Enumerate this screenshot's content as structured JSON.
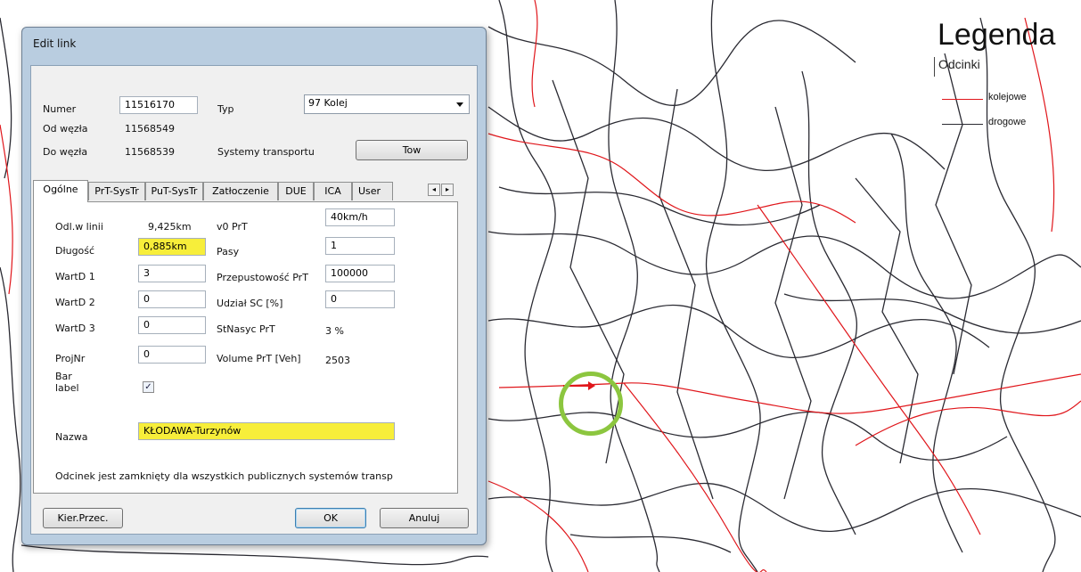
{
  "colors": {
    "rail": "#e0161b",
    "road": "#2a2a32",
    "highlight": "#f7ee3a",
    "marker": "#8cc63f"
  },
  "legend": {
    "title": "Legenda",
    "subtitle": "Odcinki",
    "items": [
      {
        "label": "kolejowe",
        "color": "#e0161b"
      },
      {
        "label": "drogowe",
        "color": "#2a2a32"
      }
    ]
  },
  "dialog": {
    "title": "Edit link",
    "numer_label": "Numer",
    "numer_value": "11516170",
    "typ_label": "Typ",
    "typ_value": "97 Kolej",
    "od_label": "Od węzła",
    "od_value": "11568549",
    "do_label": "Do węzła",
    "do_value": "11568539",
    "systemy_label": "Systemy transportu",
    "systemy_button": "Tow",
    "tabs": [
      "Ogólne",
      "PrT-SysTr",
      "PuT-SysTr",
      "Zatłoczenie",
      "DUE",
      "ICA",
      "User"
    ],
    "general": {
      "odl_label": "Odl.w linii",
      "odl_value": "9,425km",
      "dlugosc_label": "Długość",
      "dlugosc_value": "0,885km",
      "wartd1_label": "WartD 1",
      "wartd1_value": "3",
      "wartd2_label": "WartD 2",
      "wartd2_value": "0",
      "wartd3_label": "WartD 3",
      "wartd3_value": "0",
      "projnr_label": "ProjNr",
      "projnr_value": "0",
      "barlabel_label_1": "Bar",
      "barlabel_label_2": "label",
      "barlabel_checked": "✓",
      "v0_label": "v0 PrT",
      "v0_value": "40km/h",
      "pasy_label": "Pasy",
      "pasy_value": "1",
      "przep_label": "Przepustowość PrT",
      "przep_value": "100000",
      "udzial_label": "Udział SC [%]",
      "udzial_value": "0",
      "stnasyc_label": "StNasyc PrT",
      "stnasyc_value": "3 %",
      "volume_label": "Volume PrT [Veh]",
      "volume_value": "2503",
      "nazwa_label": "Nazwa",
      "nazwa_value": "KŁODAWA-Turzynów",
      "note": "Odcinek jest zamknięty dla wszystkich publicznych systemów transp"
    },
    "buttons": {
      "kier": "Kier.Przec.",
      "ok": "OK",
      "anuluj": "Anuluj"
    }
  }
}
